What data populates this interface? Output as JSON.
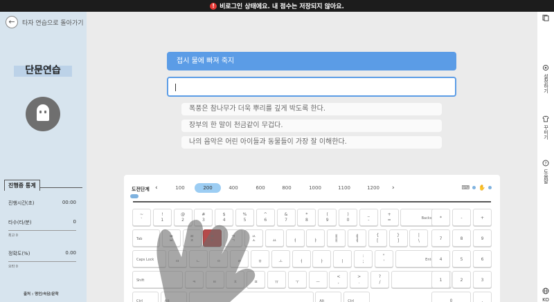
{
  "banner": {
    "text": "비로그인 상태에요. 내 점수는 저장되지 않아요."
  },
  "nav": {
    "back_label": "타자 연습으로 돌아가기"
  },
  "mode": {
    "title": "단문연습"
  },
  "stats": {
    "header": "진행중 통계",
    "time_label": "진행시간(초)",
    "time_value": "00:00",
    "speed_label": "타수(타/분)",
    "speed_value": "0",
    "speed_best": "최고 0",
    "accuracy_label": "정확도(%)",
    "accuracy_value": "0.00",
    "accuracy_sub": "오타 0"
  },
  "source": "출처 : 명언/속담/문학",
  "practice": {
    "current": "접시 물에 빠져 죽지",
    "next": [
      "폭풍은 참나무가 더욱 뿌리를 깊게 박도록 한다.",
      "장부의 한 말이 천금같이 무겁다.",
      "나의 음악은 어린 아이들과 동물들이 가장 잘 이해한다."
    ]
  },
  "levels": {
    "label": "도전단계",
    "items": [
      "100",
      "200",
      "400",
      "600",
      "800",
      "1000",
      "1100",
      "1200"
    ],
    "selected": "200"
  },
  "right_bar": {
    "settings": "설정하기",
    "decorate": "꾸미기",
    "help": "도움말",
    "language": "KO"
  },
  "keyboard": {
    "rows": [
      [
        [
          "~",
          "`"
        ],
        [
          "!",
          "1"
        ],
        [
          "@",
          "2"
        ],
        [
          "#",
          "3"
        ],
        [
          "$",
          "4"
        ],
        [
          "%",
          "5"
        ],
        [
          "^",
          "6"
        ],
        [
          "&",
          "7"
        ],
        [
          "*",
          "8"
        ],
        [
          "(",
          "9"
        ],
        [
          ")",
          "0"
        ],
        [
          "_",
          "-"
        ],
        [
          "+",
          "="
        ],
        [
          "",
          "Backspace"
        ]
      ],
      [
        [
          "",
          "Tab"
        ],
        [
          "ㅃ",
          "ㅂ"
        ],
        [
          "ㅉ",
          "ㅈ"
        ],
        [
          "ㄸ",
          "ㄷ"
        ],
        [
          "ㄲ",
          "ㄱ"
        ],
        [
          "ㅆ",
          "ㅅ"
        ],
        [
          "",
          "ㅛ"
        ],
        [
          "",
          "ㅕ"
        ],
        [
          "",
          "ㅑ"
        ],
        [
          "ㅒ",
          "ㅐ"
        ],
        [
          "ㅖ",
          "ㅔ"
        ],
        [
          "{",
          "["
        ],
        [
          "}",
          "]"
        ],
        [
          "|",
          "\\"
        ]
      ],
      [
        [
          "",
          "Caps Lock"
        ],
        [
          "",
          "ㅁ"
        ],
        [
          "",
          "ㄴ"
        ],
        [
          "",
          "ㅇ"
        ],
        [
          "",
          "ㄹ"
        ],
        [
          "",
          "ㅎ"
        ],
        [
          "",
          "ㅗ"
        ],
        [
          "",
          "ㅓ"
        ],
        [
          "",
          "ㅏ"
        ],
        [
          "",
          "ㅣ"
        ],
        [
          ":",
          ";"
        ],
        [
          "\"",
          "'"
        ],
        [
          "",
          "Enter"
        ]
      ],
      [
        [
          "",
          "Shift"
        ],
        [
          "",
          "ㅋ"
        ],
        [
          "",
          "ㅌ"
        ],
        [
          "",
          "ㅊ"
        ],
        [
          "",
          "ㅍ"
        ],
        [
          "",
          "ㅠ"
        ],
        [
          "",
          "ㅜ"
        ],
        [
          "",
          "ㅡ"
        ],
        [
          "<",
          ","
        ],
        [
          ">",
          "."
        ],
        [
          "?",
          "/"
        ],
        [
          "",
          "Shift"
        ]
      ],
      [
        [
          "",
          "Ctrl"
        ],
        [
          "",
          "Alt"
        ],
        [
          "",
          ""
        ],
        [
          "",
          "Alt"
        ],
        [
          "",
          "Ctrl"
        ]
      ]
    ],
    "numpad": [
      [
        "*",
        "-",
        "+"
      ],
      [
        "7",
        "8",
        "9"
      ],
      [
        "4",
        "5",
        "6"
      ],
      [
        "1",
        "2",
        "3"
      ],
      [
        "0",
        "."
      ]
    ]
  }
}
